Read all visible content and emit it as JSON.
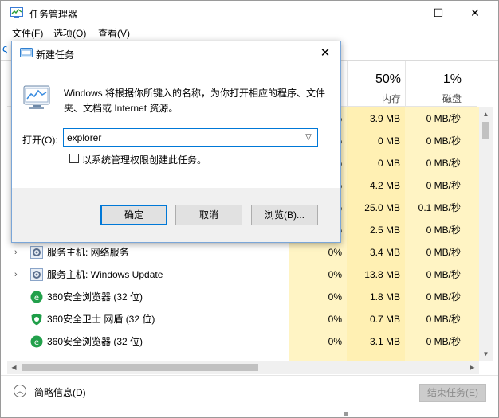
{
  "window": {
    "title": "任务管理器",
    "controls": {
      "minimize": "—",
      "maximize": "☐",
      "close": "✕"
    }
  },
  "menubar": {
    "items": [
      "文件(F)",
      "选项(O)",
      "查看(V)"
    ]
  },
  "columns": [
    {
      "percent": "",
      "label": ""
    },
    {
      "percent": "50%",
      "label": "内存"
    },
    {
      "percent": "1%",
      "label": "磁盘"
    }
  ],
  "processes": [
    {
      "expander": "",
      "icon": "",
      "name": "",
      "cpu": "0%",
      "memory": "3.9 MB",
      "disk": "0 MB/秒"
    },
    {
      "expander": "",
      "icon": "",
      "name": "",
      "cpu": "0%",
      "memory": "0 MB",
      "disk": "0 MB/秒"
    },
    {
      "expander": "",
      "icon": "",
      "name": "",
      "cpu": "0%",
      "memory": "0 MB",
      "disk": "0 MB/秒"
    },
    {
      "expander": "",
      "icon": "",
      "name": "",
      "cpu": "0%",
      "memory": "4.2 MB",
      "disk": "0 MB/秒"
    },
    {
      "expander": "",
      "icon": "",
      "name": "",
      "cpu": "0%",
      "memory": "25.0 MB",
      "disk": "0.1 MB/秒"
    },
    {
      "expander": "",
      "icon": "",
      "name": "",
      "cpu": "0%",
      "memory": "2.5 MB",
      "disk": "0 MB/秒"
    },
    {
      "expander": "›",
      "icon": "gear-icon",
      "name": "服务主机: 网络服务",
      "cpu": "0%",
      "memory": "3.4 MB",
      "disk": "0 MB/秒"
    },
    {
      "expander": "›",
      "icon": "gear-icon",
      "name": "服务主机: Windows Update",
      "cpu": "0%",
      "memory": "13.8 MB",
      "disk": "0 MB/秒"
    },
    {
      "expander": "",
      "icon": "360-browser-icon",
      "name": "360安全浏览器 (32 位)",
      "cpu": "0%",
      "memory": "1.8 MB",
      "disk": "0 MB/秒"
    },
    {
      "expander": "",
      "icon": "360-guard-icon",
      "name": "360安全卫士 网盾 (32 位)",
      "cpu": "0%",
      "memory": "0.7 MB",
      "disk": "0 MB/秒"
    },
    {
      "expander": "",
      "icon": "360-browser-icon",
      "name": "360安全浏览器 (32 位)",
      "cpu": "0%",
      "memory": "3.1 MB",
      "disk": "0 MB/秒"
    }
  ],
  "footer": {
    "fewer_details": "简略信息(D)",
    "end_task": "结束任务(E)"
  },
  "dialog": {
    "title": "新建任务",
    "description": "Windows 将根据你所键入的名称，为你打开相应的程序、文件夹、文档或 Internet 资源。",
    "open_label": "打开(O):",
    "open_value": "explorer",
    "admin_checkbox": "以系统管理权限创建此任务。",
    "admin_checked": false,
    "buttons": {
      "ok": "确定",
      "cancel": "取消",
      "browse": "浏览(B)..."
    }
  },
  "colors": {
    "accent": "#0078d7",
    "cpu_heat": "#fff4c4",
    "mem_heat": "#fff0b3"
  }
}
